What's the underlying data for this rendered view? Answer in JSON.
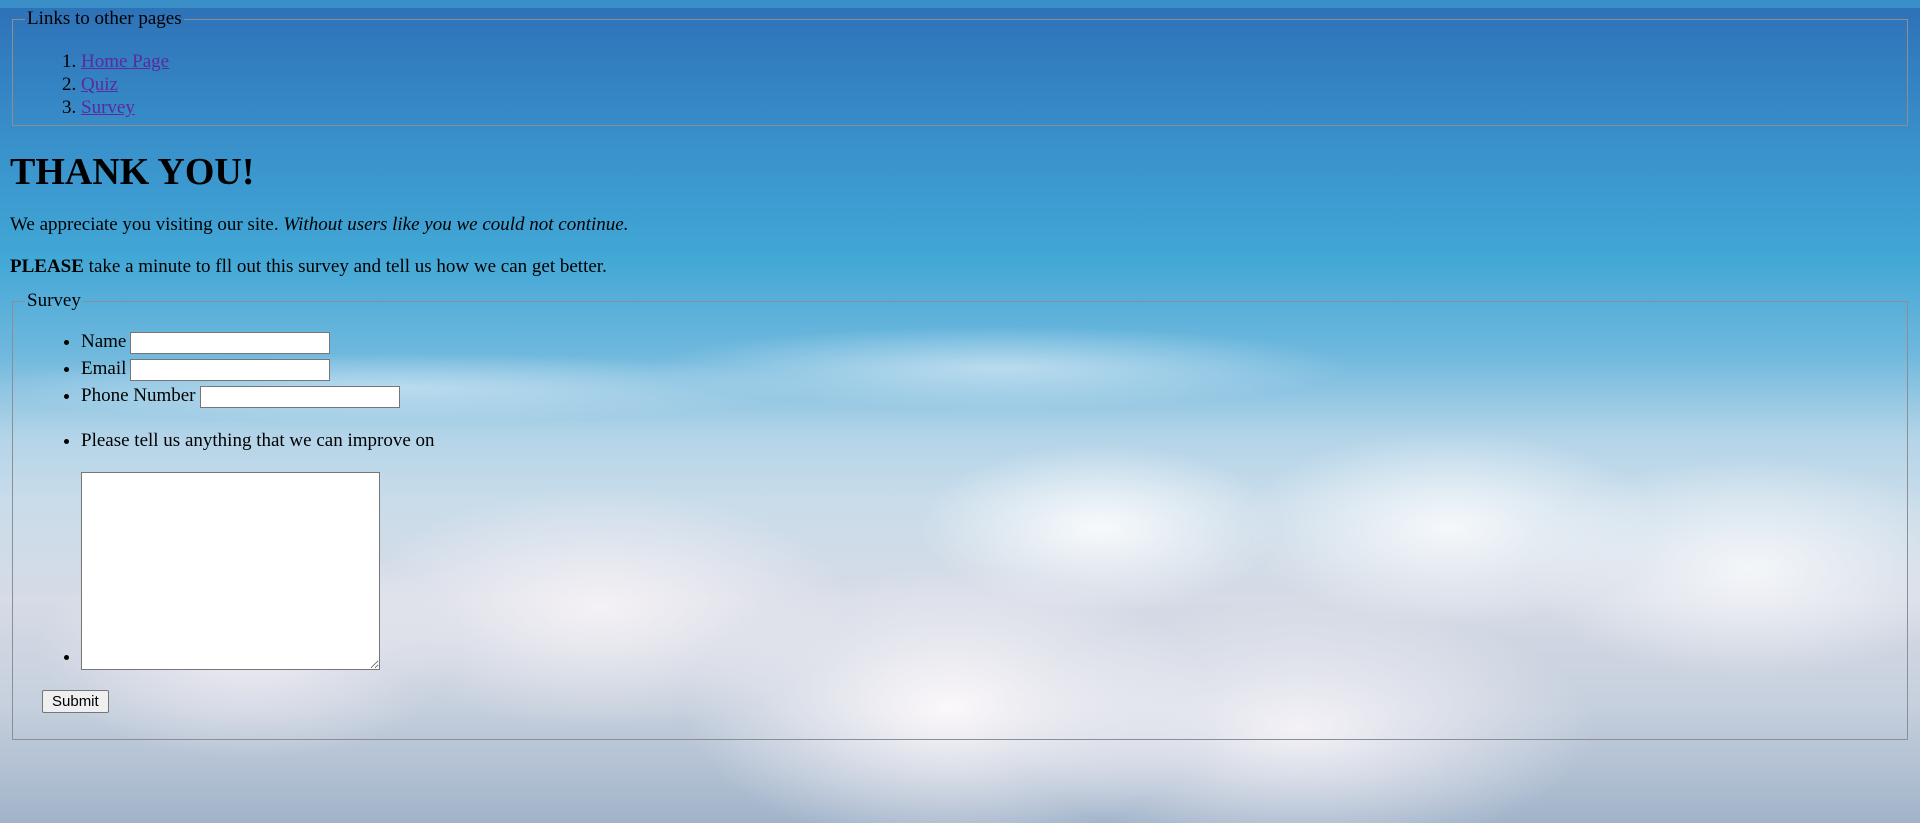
{
  "links": {
    "legend": "Links to other pages",
    "items": [
      {
        "label": "Home Page"
      },
      {
        "label": "Quiz"
      },
      {
        "label": "Survey"
      }
    ]
  },
  "heading": "THANK YOU!",
  "intro": {
    "plain": "We appreciate you visiting our site.",
    "italic": "Without users like you we could not continue."
  },
  "request": {
    "bold": "PLEASE",
    "rest": "take a minute to fll out this survey and tell us how we can get better."
  },
  "survey": {
    "legend": "Survey",
    "name_label": "Name",
    "name_value": "",
    "email_label": "Email",
    "email_value": "",
    "phone_label": "Phone Number",
    "phone_value": "",
    "improve_label": "Please tell us anything that we can improve on",
    "improve_value": "",
    "submit_label": "Submit"
  },
  "colors": {
    "link": "#5a2a9e",
    "border": "#8a8f95"
  }
}
